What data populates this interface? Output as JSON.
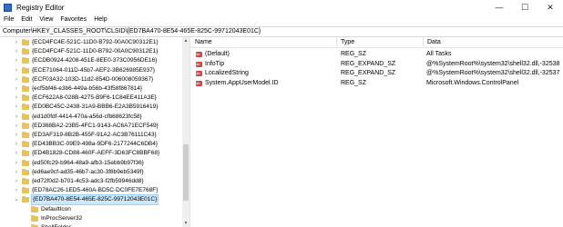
{
  "window": {
    "title": "Registry Editor",
    "minimize_glyph": "—",
    "maximize_glyph": "☐",
    "close_glyph": "✕"
  },
  "menu": [
    "File",
    "Edit",
    "View",
    "Favorites",
    "Help"
  ],
  "address": "Computer\\HKEY_CLASSES_ROOT\\CLSID\\{ED7BA470-8E54-465E-825C-99712043E01C}",
  "tree": {
    "items": [
      {
        "label": "{ECD4FC4E-521C-11D0-B792-00A0C90312E1}",
        "expanded": false,
        "selected": false
      },
      {
        "label": "{ECD4FC4F-521C-11D0-B792-00A0C90312E1}",
        "expanded": false,
        "selected": false
      },
      {
        "label": "{ECDB0924-4208-451E-8EE0-373C0956DE16}",
        "expanded": false,
        "selected": false
      },
      {
        "label": "{ECE71064-011D-45b7-AEF2-3B626985E937}",
        "expanded": false,
        "selected": false
      },
      {
        "label": "{ECF03A32-103D-11d2-854D-006008059367}",
        "expanded": false,
        "selected": false
      },
      {
        "label": "{ecf5bf46-e3b6-449a-b56b-43f58f867814}",
        "expanded": false,
        "selected": false
      },
      {
        "label": "{ECF622A8-028B-4275-B9F6-1C84EE411A3E}",
        "expanded": false,
        "selected": false
      },
      {
        "label": "{ED0BC45C-2438-31A9-BBB6-E2A3B5916419}",
        "expanded": false,
        "selected": false
      },
      {
        "label": "{ed1d0fdf-4414-470a-a56d-cfb68623fc58}",
        "expanded": false,
        "selected": false
      },
      {
        "label": "{ED368BA2-23B5-4FC1-9143-AC6A71ECF549}",
        "expanded": false,
        "selected": false
      },
      {
        "label": "{ED3AF319-8B2B-455F-91A2-AC3B76111C43}",
        "expanded": false,
        "selected": false
      },
      {
        "label": "{ED43BB3C-09E9-498a-9DF6-2177244C6DB4}",
        "expanded": false,
        "selected": false
      },
      {
        "label": "{ED4B1828-CD88-460F-AEFF-3D63FC8BBF68}",
        "expanded": false,
        "selected": false
      },
      {
        "label": "{ed50fc29-b964-48a9-afb3-15ebb9b97f36}",
        "expanded": false,
        "selected": false
      },
      {
        "label": "{ed6ae9cf-ad35-46b7-ac30-3f8b9eb5349f}",
        "expanded": false,
        "selected": false
      },
      {
        "label": "{ed72f0d2-b701-4c53-adc3-f2fb59946dd8}",
        "expanded": false,
        "selected": false
      },
      {
        "label": "{ED78AC26-1ED5-460A-BD5C-DC0FE7E768F}",
        "expanded": false,
        "selected": false
      },
      {
        "label": "{ED7BA470-8E54-465E-825C-99712043E01C}",
        "expanded": true,
        "selected": true
      },
      {
        "label": "DefaultIcon",
        "child": true
      },
      {
        "label": "InProcServer32",
        "child": true
      },
      {
        "label": "ShellFolder",
        "child": true
      }
    ]
  },
  "columns": {
    "name": "Name",
    "type": "Type",
    "data": "Data"
  },
  "values": [
    {
      "name": "(Default)",
      "type": "REG_SZ",
      "data": "All Tasks"
    },
    {
      "name": "InfoTip",
      "type": "REG_EXPAND_SZ",
      "data": "@%SystemRoot%\\system32\\shell32.dll,-32538"
    },
    {
      "name": "LocalizedString",
      "type": "REG_EXPAND_SZ",
      "data": "@%SystemRoot%\\system32\\shell32.dll,-32537"
    },
    {
      "name": "System.AppUserModel.ID",
      "type": "REG_SZ",
      "data": "Microsoft.Windows.ControlPanel"
    }
  ],
  "colors": {
    "selection": "#cce8ff",
    "folder": "#e8c25a",
    "string_icon": "#d24747"
  }
}
